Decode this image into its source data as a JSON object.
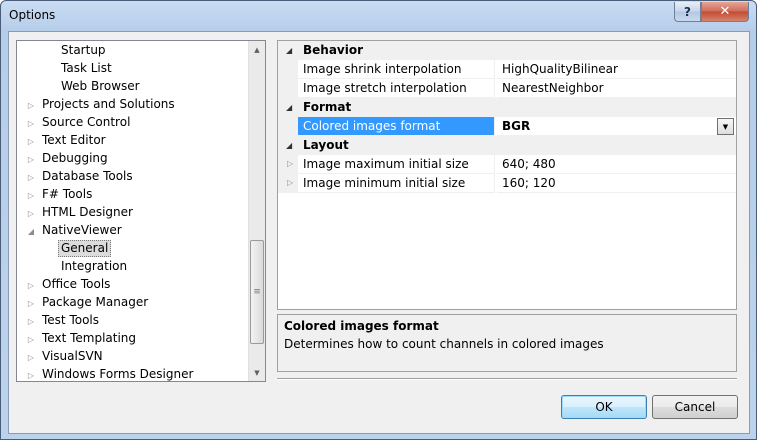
{
  "window": {
    "title": "Options",
    "help_glyph": "?",
    "close_glyph": "✕"
  },
  "tree": {
    "items": [
      {
        "label": "Startup",
        "level": 2,
        "expander": ""
      },
      {
        "label": "Task List",
        "level": 2,
        "expander": ""
      },
      {
        "label": "Web Browser",
        "level": 2,
        "expander": ""
      },
      {
        "label": "Projects and Solutions",
        "level": 1,
        "expander": "collapsed"
      },
      {
        "label": "Source Control",
        "level": 1,
        "expander": "collapsed"
      },
      {
        "label": "Text Editor",
        "level": 1,
        "expander": "collapsed"
      },
      {
        "label": "Debugging",
        "level": 1,
        "expander": "collapsed"
      },
      {
        "label": "Database Tools",
        "level": 1,
        "expander": "collapsed"
      },
      {
        "label": "F# Tools",
        "level": 1,
        "expander": "collapsed"
      },
      {
        "label": "HTML Designer",
        "level": 1,
        "expander": "collapsed"
      },
      {
        "label": "NativeViewer",
        "level": 1,
        "expander": "expanded"
      },
      {
        "label": "General",
        "level": 2,
        "expander": "",
        "selected": true
      },
      {
        "label": "Integration",
        "level": 2,
        "expander": ""
      },
      {
        "label": "Office Tools",
        "level": 1,
        "expander": "collapsed"
      },
      {
        "label": "Package Manager",
        "level": 1,
        "expander": "collapsed"
      },
      {
        "label": "Test Tools",
        "level": 1,
        "expander": "collapsed"
      },
      {
        "label": "Text Templating",
        "level": 1,
        "expander": "collapsed"
      },
      {
        "label": "VisualSVN",
        "level": 1,
        "expander": "collapsed"
      },
      {
        "label": "Windows Forms Designer",
        "level": 1,
        "expander": "collapsed"
      }
    ]
  },
  "property_grid": {
    "categories": [
      {
        "name": "Behavior",
        "properties": [
          {
            "name": "Image shrink interpolation",
            "value": "HighQualityBilinear"
          },
          {
            "name": "Image stretch interpolation",
            "value": "NearestNeighbor"
          }
        ]
      },
      {
        "name": "Format",
        "properties": [
          {
            "name": "Colored images format",
            "value": "BGR",
            "selected": true
          }
        ]
      },
      {
        "name": "Layout",
        "properties": [
          {
            "name": "Image maximum initial size",
            "value": "640; 480",
            "expandable": true
          },
          {
            "name": "Image minimum initial size",
            "value": "160; 120",
            "expandable": true
          }
        ]
      }
    ]
  },
  "description": {
    "title": "Colored images format",
    "text": "Determines how to count channels in colored images"
  },
  "buttons": {
    "ok": "OK",
    "cancel": "Cancel"
  },
  "colors": {
    "selection": "#3399ff",
    "accent_border": "#3c7fb1"
  }
}
